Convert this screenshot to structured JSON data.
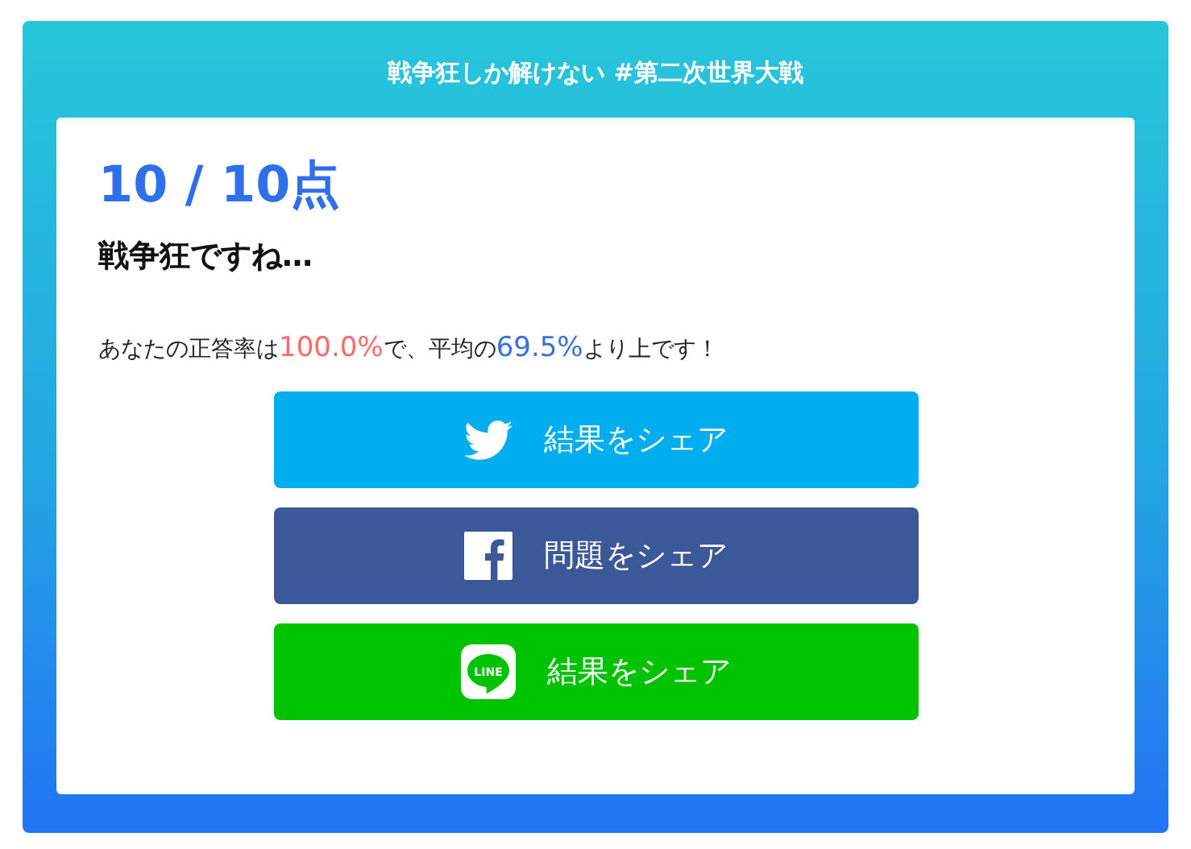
{
  "header": {
    "title": "戦争狂しか解けない #第二次世界大戦"
  },
  "result": {
    "score": "10 / 10点",
    "verdict": "戦争狂ですね…",
    "sentence": [
      {
        "kind": "plain",
        "text": "あなたの正答率は"
      },
      {
        "kind": "own",
        "text": "100.0%"
      },
      {
        "kind": "plain",
        "text": "で、平均の"
      },
      {
        "kind": "average",
        "text": "69.5%"
      },
      {
        "kind": "plain",
        "text": "より上です！"
      }
    ]
  },
  "share_buttons": [
    {
      "kind": "twitter",
      "label": "結果をシェア"
    },
    {
      "kind": "facebook",
      "label": "問題をシェア"
    },
    {
      "kind": "line",
      "label": "結果をシェア",
      "logo_text": "LINE"
    }
  ]
}
